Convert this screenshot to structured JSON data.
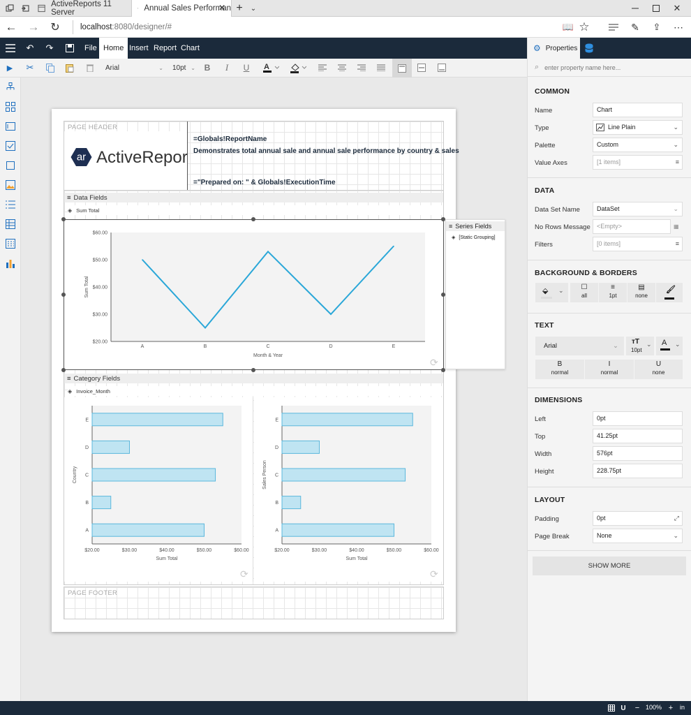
{
  "browser": {
    "tabs": [
      {
        "label": "ActiveReports 11 Server"
      },
      {
        "label": "Annual Sales Performan"
      }
    ],
    "url_host": "localhost",
    "url_rest": ":8080/designer/#"
  },
  "designer": {
    "menu": [
      "File",
      "Home",
      "Insert",
      "Report",
      "Chart"
    ],
    "font": "Arial",
    "font_size": "10pt"
  },
  "report": {
    "page_header_label": "PAGE HEADER",
    "page_footer_label": "PAGE FOOTER",
    "logo_text": "ActiveReports",
    "logo_mark": "ar",
    "title_expr": "=Globals!ReportName",
    "description": "Demonstrates total annual sale and annual sale performance by country & sales",
    "prepared_expr": "=\"Prepared on: \" & Globals!ExecutionTime",
    "data_fields_label": "Data Fields",
    "data_field_item": "Sum Total",
    "series_fields_label": "Series Fields",
    "series_field_item": "[Static Grouping]",
    "category_fields_label": "Category Fields",
    "category_field_item": "Invoice_Month"
  },
  "chart_data": [
    {
      "type": "line",
      "categories": [
        "A",
        "B",
        "C",
        "D",
        "E"
      ],
      "values": [
        50,
        25,
        53,
        30,
        55
      ],
      "xlabel": "Month & Year",
      "ylabel": "Sum Total",
      "ylim": [
        20,
        60
      ],
      "yticks": [
        "$20.00",
        "$30.00",
        "$40.00",
        "$50.00",
        "$60.00"
      ],
      "color": "#2aa7d8"
    },
    {
      "type": "bar",
      "orientation": "horizontal",
      "categories": [
        "A",
        "B",
        "C",
        "D",
        "E"
      ],
      "values": [
        50,
        25,
        53,
        30,
        55
      ],
      "xlabel": "Sum Total",
      "ylabel": "Country",
      "xlim": [
        20,
        60
      ],
      "xticks": [
        "$20.00",
        "$30.00",
        "$40.00",
        "$50.00",
        "$60.00"
      ],
      "color": "#bfe4f2"
    },
    {
      "type": "bar",
      "orientation": "horizontal",
      "categories": [
        "A",
        "B",
        "C",
        "D",
        "E"
      ],
      "values": [
        50,
        25,
        53,
        30,
        55
      ],
      "xlabel": "Sum Total",
      "ylabel": "Sales Person",
      "xlim": [
        20,
        60
      ],
      "xticks": [
        "$20.00",
        "$30.00",
        "$40.00",
        "$50.00",
        "$60.00"
      ],
      "color": "#bfe4f2"
    }
  ],
  "properties": {
    "tab_label": "Properties",
    "search_placeholder": "enter property name here...",
    "sections": {
      "common": "COMMON",
      "data": "DATA",
      "background": "BACKGROUND & BORDERS",
      "text": "TEXT",
      "dimensions": "DIMENSIONS",
      "layout": "LAYOUT"
    },
    "common": {
      "name_label": "Name",
      "name_value": "Chart",
      "type_label": "Type",
      "type_value": "Line Plain",
      "palette_label": "Palette",
      "palette_value": "Custom",
      "valueaxes_label": "Value Axes",
      "valueaxes_value": "[1 items]"
    },
    "data": {
      "dataset_label": "Data Set Name",
      "dataset_value": "DataSet",
      "norows_label": "No Rows Message",
      "norows_value": "<Empty>",
      "filters_label": "Filters",
      "filters_value": "[0 items]"
    },
    "borders": {
      "style": "all",
      "width": "1pt",
      "none": "none"
    },
    "text": {
      "font": "Arial",
      "size": "10pt",
      "bold": "B",
      "bold_val": "normal",
      "italic": "I",
      "italic_val": "normal",
      "underline": "U",
      "underline_val": "none"
    },
    "dimensions": {
      "left_label": "Left",
      "left_value": "0pt",
      "top_label": "Top",
      "top_value": "41.25pt",
      "width_label": "Width",
      "width_value": "576pt",
      "height_label": "Height",
      "height_value": "228.75pt"
    },
    "layout": {
      "padding_label": "Padding",
      "padding_value": "0pt",
      "pagebreak_label": "Page Break",
      "pagebreak_value": "None"
    },
    "show_more": "SHOW MORE"
  },
  "status": {
    "zoom": "100%",
    "unit": "in"
  }
}
